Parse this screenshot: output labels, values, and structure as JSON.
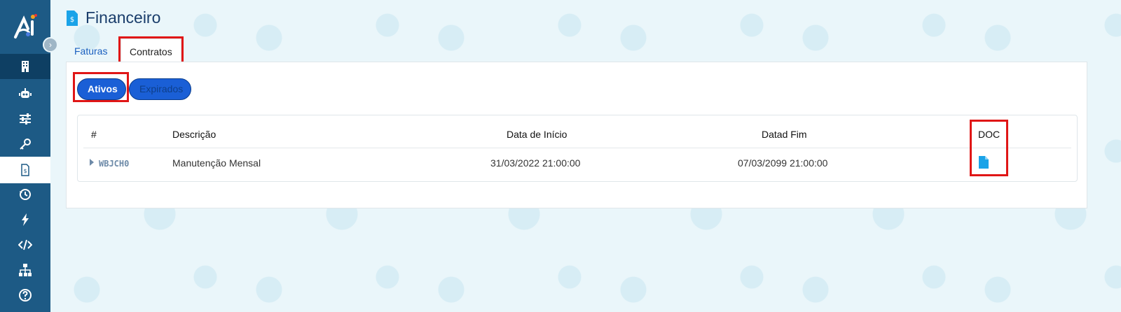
{
  "page": {
    "title": "Financeiro"
  },
  "tabs": [
    {
      "label": "Faturas"
    },
    {
      "label": "Contratos"
    }
  ],
  "filters": {
    "ativos": "Ativos",
    "expirados": "Expirados"
  },
  "table": {
    "headers": [
      "#",
      "Descrição",
      "Data de Início",
      "Datad Fim",
      "DOC"
    ],
    "rows": [
      {
        "id": "WBJCH0",
        "descricao": "Manutenção Mensal",
        "data_inicio": "31/03/2022 21:00:00",
        "data_fim": "07/03/2099 21:00:00"
      }
    ]
  },
  "sidebar": {
    "items": [
      {
        "icon": "building-icon"
      },
      {
        "icon": "robot-icon"
      },
      {
        "icon": "sliders-icon"
      },
      {
        "icon": "key-icon"
      },
      {
        "icon": "invoice-icon"
      },
      {
        "icon": "history-icon"
      },
      {
        "icon": "bolt-icon"
      },
      {
        "icon": "code-icon"
      },
      {
        "icon": "sitemap-icon"
      },
      {
        "icon": "help-icon"
      }
    ]
  },
  "colors": {
    "sidebar": "#1d5a85",
    "sidebar_dark": "#0e3f63",
    "accent": "#1a5fd6",
    "highlight": "#e01616",
    "doc_icon": "#1aa3e8"
  }
}
